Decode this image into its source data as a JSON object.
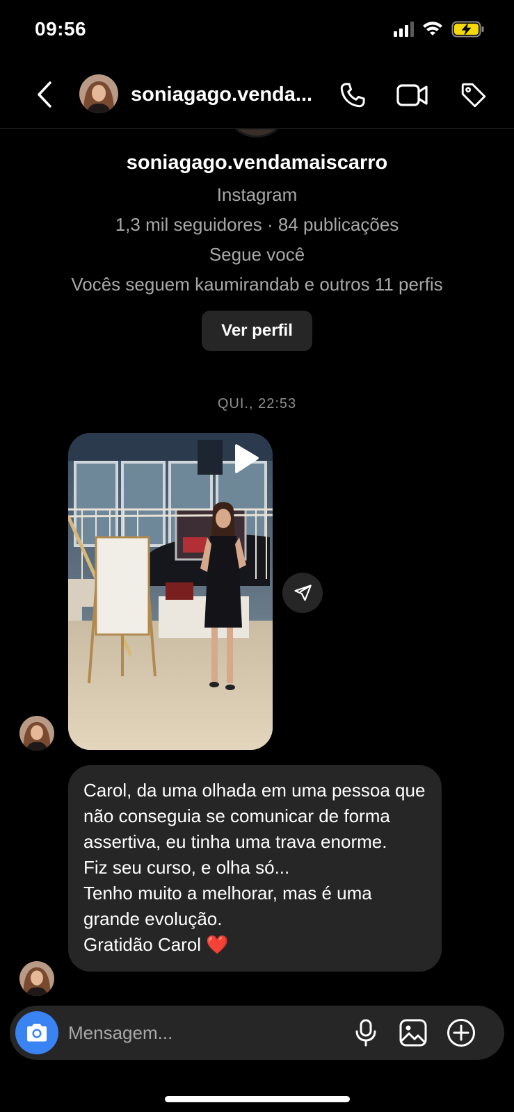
{
  "status_bar": {
    "time": "09:56",
    "signal_icon": "cellular-signal-icon",
    "wifi_icon": "wifi-icon",
    "battery_icon": "battery-charging-icon",
    "battery_color": "#f5d90a"
  },
  "header": {
    "title": "soniagago.venda...",
    "back_icon": "chevron-left-icon",
    "call_icon": "phone-icon",
    "video_icon": "video-camera-icon",
    "tag_icon": "tag-icon"
  },
  "profile": {
    "username": "soniagago.vendamaiscarro",
    "platform": "Instagram",
    "stats": "1,3 mil seguidores · 84 publicações",
    "follows_you": "Segue você",
    "mutuals": "Vocês seguem kaumirandab e outros 11 perfis",
    "view_profile_label": "Ver perfil"
  },
  "thread": {
    "timestamp": "QUI., 22:53",
    "video_message": {
      "play_icon": "play-icon",
      "share_icon": "send-icon"
    },
    "text_message": {
      "lines": [
        "Carol, da uma olhada em uma pessoa que não conseguia se comunicar de forma assertiva, eu tinha uma trava enorme.",
        "Fiz seu curso, e olha só...",
        "Tenho muito a melhorar, mas é uma grande evolução.",
        "Gratidão Carol ❤️"
      ]
    }
  },
  "composer": {
    "placeholder": "Mensagem...",
    "camera_icon": "camera-icon",
    "mic_icon": "microphone-icon",
    "gallery_icon": "image-icon",
    "add_icon": "plus-circle-icon",
    "accent_color": "#3a83f2"
  }
}
